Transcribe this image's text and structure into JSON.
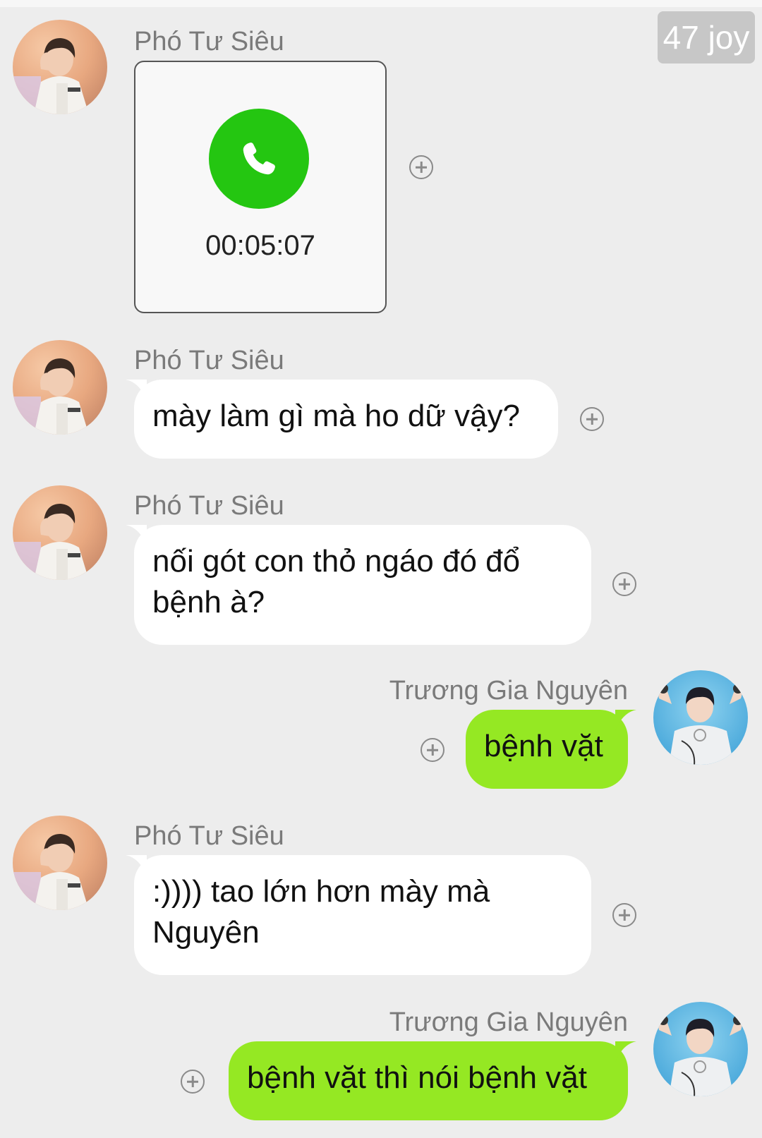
{
  "watermark": "47 joy",
  "colors": {
    "outgoing_bubble": "#95e823",
    "incoming_bubble": "#ffffff",
    "call_icon": "#24c611",
    "background": "#ededed"
  },
  "messages": [
    {
      "sender": "Phó Tư Siêu",
      "direction": "incoming",
      "type": "call",
      "call_icon": "phone-icon",
      "duration": "00:05:07"
    },
    {
      "sender": "Phó Tư Siêu",
      "direction": "incoming",
      "type": "text",
      "text": "mày làm gì mà ho dữ vậy?"
    },
    {
      "sender": "Phó Tư Siêu",
      "direction": "incoming",
      "type": "text",
      "text": "nối gót con thỏ ngáo đó đổ bệnh à?"
    },
    {
      "sender": "Trương Gia Nguyên",
      "direction": "outgoing",
      "type": "text",
      "text": "bệnh vặt"
    },
    {
      "sender": "Phó Tư Siêu",
      "direction": "incoming",
      "type": "text",
      "text": ":)))) tao lớn hơn mày mà Nguyên"
    },
    {
      "sender": "Trương Gia Nguyên",
      "direction": "outgoing",
      "type": "text",
      "text": "bệnh vặt thì nói bệnh vặt"
    }
  ]
}
